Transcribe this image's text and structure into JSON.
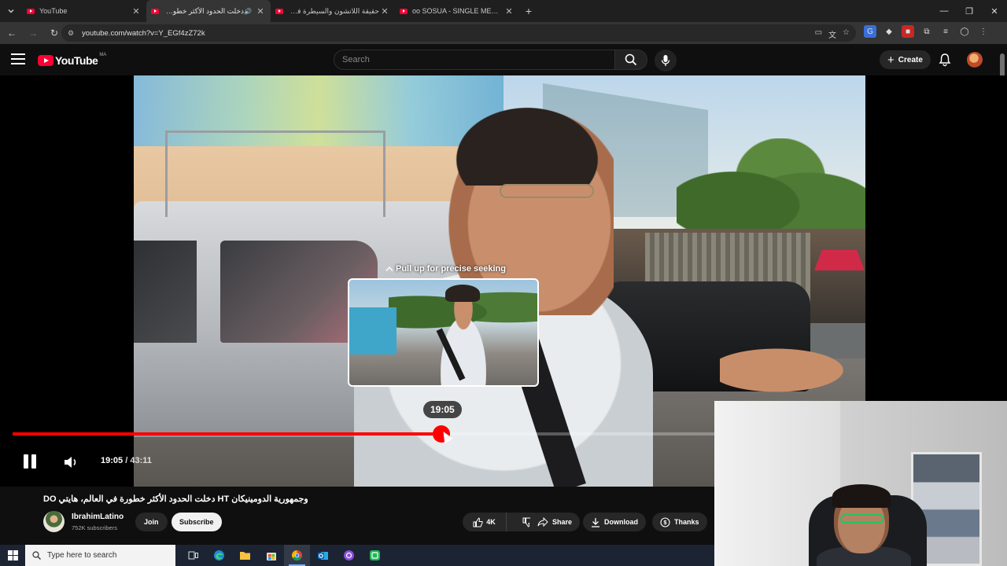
{
  "browser": {
    "tabs": [
      {
        "title": "YouTube",
        "active": false,
        "audio": false
      },
      {
        "title": "دخلت الحدود الأكثر خطورة في...",
        "active": true,
        "audio": true
      },
      {
        "title": "حقيقة اللاتشون والسيطرة في م...",
        "active": false,
        "audio": false
      },
      {
        "title": "oo SOSUA - SINGLE MEN'S PAR...",
        "active": false,
        "audio": false
      }
    ],
    "new_tab": "+",
    "url": "youtube.com/watch?v=Y_EGf4zZ72k"
  },
  "youtube": {
    "logo_text": "YouTube",
    "region": "MA",
    "search_placeholder": "Search",
    "create_label": "Create"
  },
  "player": {
    "seek_hint": "Pull up for precise seeking",
    "hover_time": "19:05",
    "current_time": "19:05",
    "separator": "/",
    "duration": "43:11",
    "progress_fraction": 0.611
  },
  "video": {
    "title": "وجمهورية الدومينيكان HT دخلت الحدود الأكثر خطورة في العالم، هايتي DO",
    "channel_name": "IbrahimLatino",
    "subscribers": "752K subscribers",
    "join_label": "Join",
    "subscribe_label": "Subscribe",
    "likes": "4K",
    "share_label": "Share",
    "download_label": "Download",
    "thanks_label": "Thanks"
  },
  "taskbar": {
    "search_placeholder": "Type here to search"
  },
  "colors": {
    "accent_red": "#ff0000",
    "background": "#0f0f0f"
  }
}
